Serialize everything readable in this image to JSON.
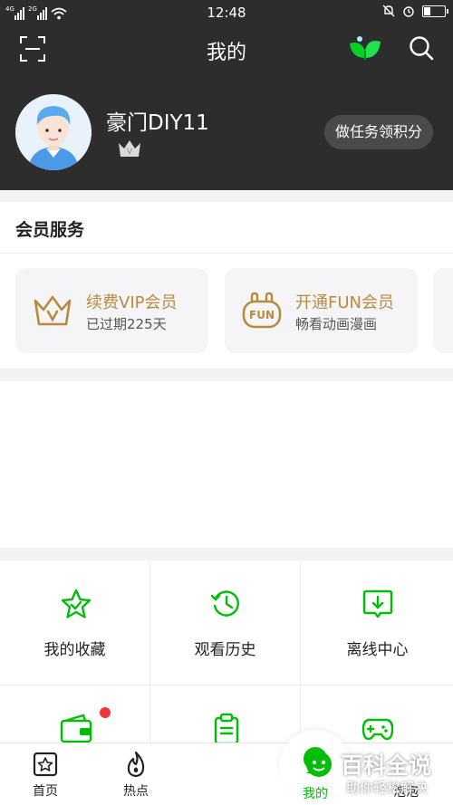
{
  "status_bar": {
    "net1": "4G",
    "net2": "2G",
    "time": "12:48",
    "battery_level": 0.3
  },
  "header": {
    "title": "我的",
    "username": "豪门DIY11",
    "task_button": "做任务领积分"
  },
  "member_services": {
    "title": "会员服务",
    "cards": [
      {
        "title": "续费VIP会员",
        "subtitle": "已过期225天"
      },
      {
        "title": "开通FUN会员",
        "subtitle": "畅看动画漫画"
      }
    ]
  },
  "grid": {
    "items": [
      {
        "label": "我的收藏",
        "icon": "star-icon"
      },
      {
        "label": "观看历史",
        "icon": "history-clock-icon"
      },
      {
        "label": "离线中心",
        "icon": "download-icon"
      },
      {
        "label": "",
        "icon": "wallet-icon"
      },
      {
        "label": "",
        "icon": "clipboard-icon"
      },
      {
        "label": "",
        "icon": "gamepad-icon"
      }
    ]
  },
  "bottom_nav": {
    "items": [
      {
        "label": "首页",
        "icon": "home-icon"
      },
      {
        "label": "热点",
        "icon": "flame-icon"
      },
      {
        "label": "我的",
        "icon": "mine-icon"
      },
      {
        "label": "泡泡",
        "icon": "bubble-icon"
      }
    ]
  },
  "watermark": {
    "title": "百科全说",
    "subtitle": "助你轻松解决"
  },
  "colors": {
    "accent_green": "#00be06",
    "gold": "#b98a3e",
    "header_bg": "#2d2d2d",
    "red_dot": "#f2353a"
  }
}
